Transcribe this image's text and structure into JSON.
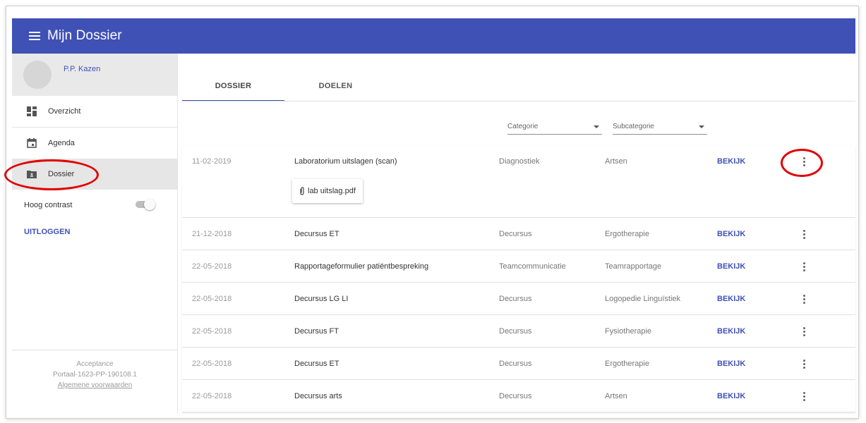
{
  "app": {
    "title": "Mijn Dossier"
  },
  "user": {
    "name": "P.P. Kazen"
  },
  "nav": {
    "items": [
      {
        "label": "Overzicht",
        "icon": "dashboard-icon"
      },
      {
        "label": "Agenda",
        "icon": "calendar-icon"
      },
      {
        "label": "Dossier",
        "icon": "folder-icon",
        "active": true
      }
    ],
    "contrast_label": "Hoog contrast",
    "logout_label": "UITLOGGEN"
  },
  "footer": {
    "env": "Acceptance",
    "version": "Portaal-1623-PP-190108.1",
    "terms": "Algemene voorwaarden"
  },
  "tabs": [
    {
      "label": "DOSSIER",
      "active": true
    },
    {
      "label": "DOELEN"
    }
  ],
  "filters": {
    "category": "Categorie",
    "subcategory": "Subcategorie"
  },
  "view_label": "BEKIJK",
  "rows": [
    {
      "date": "11-02-2019",
      "name": "Laboratorium uitslagen (scan)",
      "category": "Diagnostiek",
      "subcategory": "Artsen",
      "attachment": "lab uitslag.pdf"
    },
    {
      "date": "21-12-2018",
      "name": "Decursus ET",
      "category": "Decursus",
      "subcategory": "Ergotherapie"
    },
    {
      "date": "22-05-2018",
      "name": "Rapportageformulier patiëntbespreking",
      "category": "Teamcommunicatie",
      "subcategory": "Teamrapportage"
    },
    {
      "date": "22-05-2018",
      "name": "Decursus LG LI",
      "category": "Decursus",
      "subcategory": "Logopedie Linguïstiek"
    },
    {
      "date": "22-05-2018",
      "name": "Decursus FT",
      "category": "Decursus",
      "subcategory": "Fysiotherapie"
    },
    {
      "date": "22-05-2018",
      "name": "Decursus ET",
      "category": "Decursus",
      "subcategory": "Ergotherapie"
    },
    {
      "date": "22-05-2018",
      "name": "Decursus arts",
      "category": "Decursus",
      "subcategory": "Artsen"
    }
  ],
  "colors": {
    "primary": "#3f51b5",
    "highlight": "#e00000"
  }
}
